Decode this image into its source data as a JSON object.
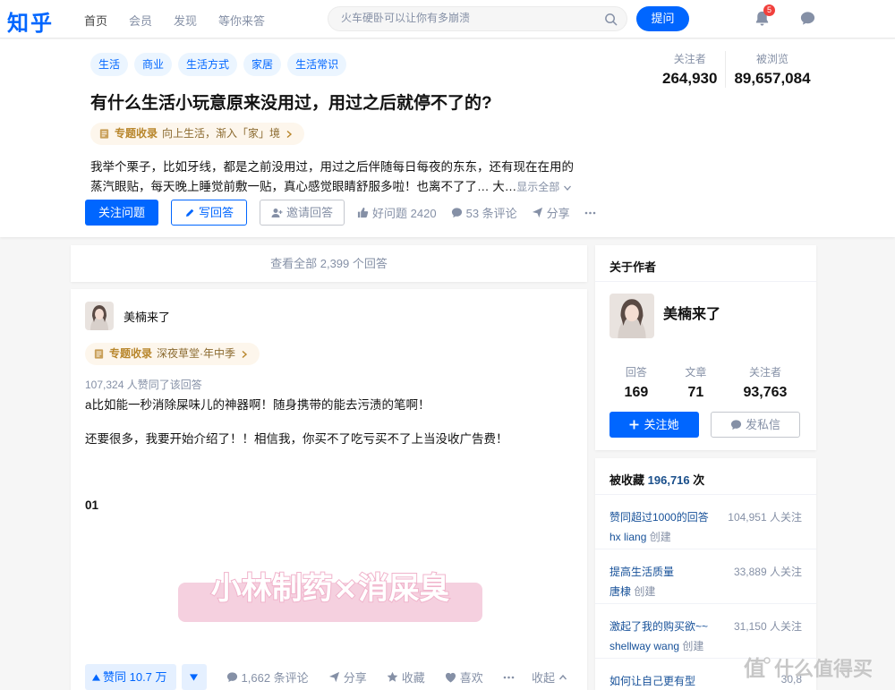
{
  "app": {
    "logo": "知乎"
  },
  "nav": {
    "items": [
      "首页",
      "会员",
      "发现",
      "等你来答"
    ]
  },
  "search": {
    "placeholder": "火车硬卧可以让你有多崩溃"
  },
  "header": {
    "ask_label": "提问",
    "notification_count": "5"
  },
  "question": {
    "topics": [
      "生活",
      "商业",
      "生活方式",
      "家居",
      "生活常识"
    ],
    "title": "有什么生活小玩意原来没用过，用过之后就停不了的?",
    "collection": {
      "label": "专题收录",
      "text": "向上生活，渐入「家」境"
    },
    "description": "我举个栗子，比如牙线，都是之前没用过，用过之后伴随每日每夜的东东，还有现在在用的蒸汽眼贴，每天晚上睡觉前敷一贴，真心感觉眼睛舒服多啦！也离不了了… 大…",
    "show_all": "显示全部",
    "actions": {
      "follow": "关注问题",
      "write": "写回答",
      "invite": "邀请回答",
      "good_question": "好问题 2420",
      "comments": "53 条评论",
      "share": "分享"
    },
    "stats": {
      "followers_label": "关注者",
      "followers": "264,930",
      "views_label": "被浏览",
      "views": "89,657,084"
    }
  },
  "view_all": "查看全部 2,399 个回答",
  "answer": {
    "author": "美楠来了",
    "collection": {
      "label": "专题收录",
      "text": "深夜草堂·年中季"
    },
    "voted_text": "107,324 人赞同了该回答",
    "paragraphs": [
      "a比如能一秒消除屎味儿的神器啊！随身携带的能去污渍的笔啊！",
      "还要很多，我要开始介绍了！！相信我，你买不了吃亏买不了上当没收广告费！"
    ],
    "section": "01",
    "banner_text": "小林制药×消屎臭",
    "bar": {
      "vote": "赞同 10.7 万",
      "comments": "1,662 条评论",
      "share": "分享",
      "collect": "收藏",
      "like": "喜欢",
      "collapse": "收起"
    }
  },
  "about_author": {
    "title": "关于作者",
    "name": "美楠来了",
    "stats": [
      {
        "label": "回答",
        "value": "169"
      },
      {
        "label": "文章",
        "value": "71"
      },
      {
        "label": "关注者",
        "value": "93,763"
      }
    ],
    "follow": "关注她",
    "message": "发私信"
  },
  "collections": {
    "title_prefix": "被收藏",
    "count": "196,716",
    "title_suffix": "次",
    "items": [
      {
        "title": "赞同超过1000的回答",
        "author": "hx liang",
        "created": "创建",
        "followers": "104,951 人关注"
      },
      {
        "title": "提高生活质量",
        "author": "唐棣",
        "created": "创建",
        "followers": "33,889 人关注"
      },
      {
        "title": "激起了我的购买欲~~",
        "author": "shellway wang",
        "created": "创建",
        "followers": "31,150 人关注"
      },
      {
        "title": "如何让自己更有型",
        "author": "",
        "created": "",
        "followers": "30,8"
      }
    ]
  },
  "watermark": "什么值得买",
  "colors": {
    "brand": "#0066ff",
    "badge": "#f1403c",
    "collection_tag": "#b8862b",
    "banner": "#f3c8d9"
  }
}
